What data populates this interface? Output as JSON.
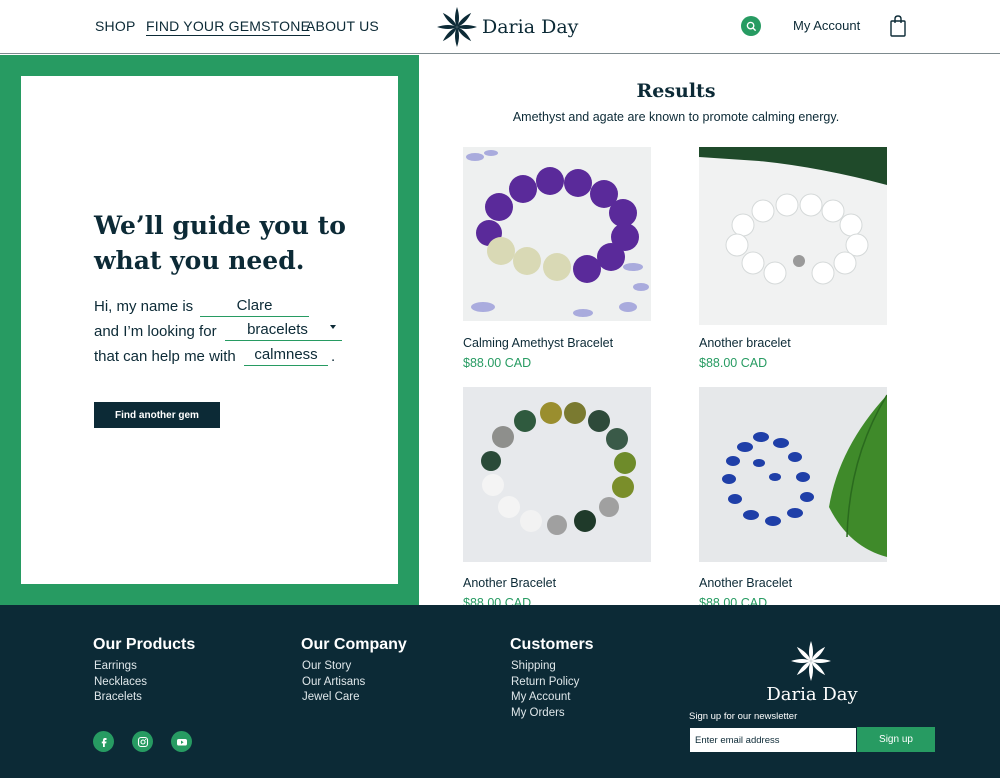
{
  "nav": {
    "shop": "SHOP",
    "find_gemstone": "FIND YOUR GEMSTONE",
    "about": "ABOUT US",
    "account": "My Account"
  },
  "brand": {
    "name": "Daria Day"
  },
  "colors": {
    "accent": "#279b62",
    "dark": "#0c2a36"
  },
  "guide": {
    "title": "We’ll guide you to what you need.",
    "line1_prefix": "Hi, my name is",
    "name_value": "Clare",
    "line2_prefix": "and I’m looking for",
    "product_value": "bracelets",
    "line3_prefix": "that can help me with",
    "need_value": "calmness",
    "line3_suffix": ".",
    "button": "Find another gem"
  },
  "results": {
    "title": "Results",
    "subtitle": "Amethyst and agate are known to promote calming energy.",
    "products": [
      {
        "name": "Calming Amethyst Bracelet",
        "price": "$88.00 CAD"
      },
      {
        "name": "Another bracelet",
        "price": "$88.00 CAD"
      },
      {
        "name": "Another Bracelet",
        "price": "$88.00 CAD"
      },
      {
        "name": "Another Bracelet",
        "price": "$88.00 CAD"
      }
    ]
  },
  "footer": {
    "products": {
      "heading": "Our Products",
      "items": [
        "Earrings",
        "Necklaces",
        "Bracelets"
      ]
    },
    "company": {
      "heading": "Our Company",
      "items": [
        "Our Story",
        "Our Artisans",
        "Jewel Care"
      ]
    },
    "customers": {
      "heading": "Customers",
      "items": [
        "Shipping",
        "Return Policy",
        "My Account",
        "My Orders"
      ]
    },
    "social": [
      "facebook-icon",
      "instagram-icon",
      "youtube-icon"
    ],
    "brand": "Daria Day",
    "newsletter_label": "Sign up for our newsletter",
    "email_placeholder": "Enter email address",
    "signup_button": "Sign up"
  }
}
